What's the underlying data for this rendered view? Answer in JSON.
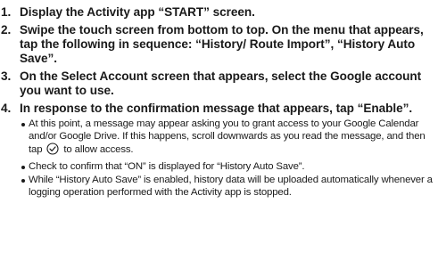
{
  "steps": [
    {
      "num": "1.",
      "text": "Display the Activity app “START” screen."
    },
    {
      "num": "2.",
      "text": "Swipe the touch screen from bottom to top. On the menu that appears, tap the following in sequence: “History/ Route Import”, “History Auto Save”."
    },
    {
      "num": "3.",
      "text": "On the Select Account screen that appears, select the Google account you want to use."
    },
    {
      "num": "4.",
      "text": "In response to the confirmation message that appears, tap “Enable”."
    }
  ],
  "notes": {
    "note1_before": "At this point, a message may appear asking you to grant access to your Google Calendar and/or Google Drive. If this happens, scroll downwards as you read the message, and then tap",
    "note1_after": "to allow access.",
    "note2": "Check to confirm that “ON” is displayed for “History Auto Save”.",
    "note3": "While “History Auto Save” is enabled, history data will be uploaded automatically whenever a logging operation performed with the Activity app is stopped."
  },
  "icons": {
    "confirm_icon": "check-circle-icon"
  }
}
